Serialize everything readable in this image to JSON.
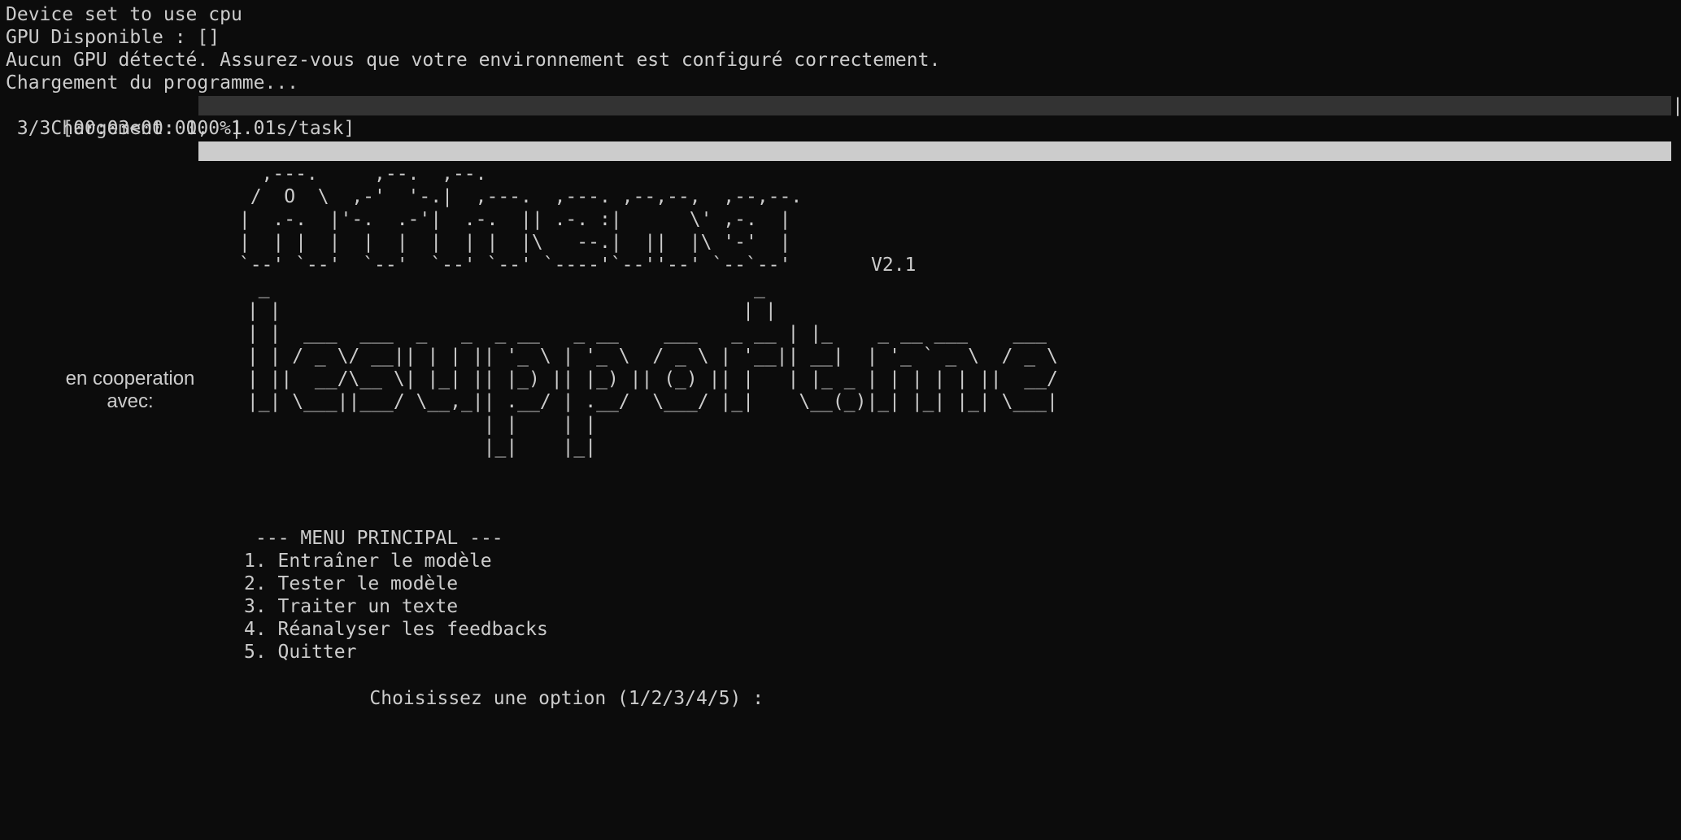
{
  "console": {
    "lines": [
      "Device set to use cpu",
      "GPU Disponible : []",
      "Aucun GPU détecté. Assurez-vous que votre environnement est configuré correctement.",
      "Chargement du programme..."
    ],
    "progress": {
      "label": "Chargement: 100%|",
      "percent": 100,
      "end": "|",
      "stats": " 3/3 [00:03<00:00,  1.01s/task]"
    }
  },
  "banner": {
    "logo_top": "   ,---.     ,--.  ,--.\n  /  O  \\  ,-'  '-.|  ,---.  ,---. ,--,--,  ,--,--.\n |  .-.  |'-.  .-'|  .-.  || .-. :|      \\' ,-.  |\n |  | |  |  |  |  |  | |  |\\   --.|  ||  |\\ '-'  |\n `--' `--'  `--'  `--' `--' `----'`--''--' `--`--'",
    "version": "V2.1",
    "logo_bottom": "  _                                           _\n | |                                         | |\n | |  ___  ___  _   _  _ __   _ __    ___   _ __ | |_    _ __ ___    ___\n | | / _ \\/ __|| | | || '_ \\ | '_ \\  / _ \\ | '__|| __|  | '_ ` _ \\  / _ \\\n | ||  __/\\__ \\| |_| || |_) || |_) || (_) || |   | |_ _ | | | | | ||  __/\n |_| \\___||___/ \\__,_|| .__/ | .__/  \\___/ |_|    \\__(_)|_| |_| |_| \\___|\n                      | |    | |\n                      |_|    |_|",
    "cooperation_label": "en cooperation\navec:"
  },
  "menu": {
    "title": "--- MENU PRINCIPAL ---",
    "items": [
      "1. Entraîner le modèle",
      "2. Tester le modèle",
      "3. Traiter un texte",
      "4. Réanalyser les feedbacks",
      "5. Quitter"
    ],
    "prompt": "Choisissez une option (1/2/3/4/5) : "
  }
}
